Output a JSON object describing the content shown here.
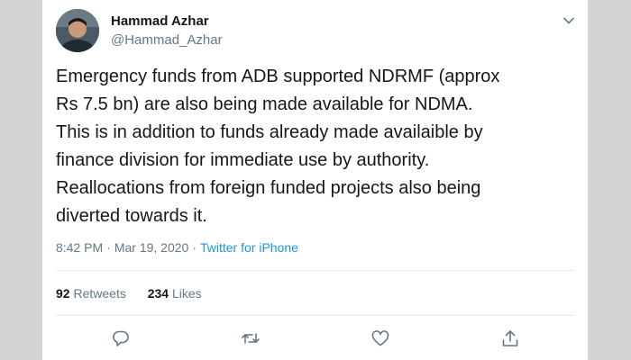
{
  "author": {
    "name": "Hammad Azhar",
    "handle": "@Hammad_Azhar"
  },
  "tweet": {
    "text": "Emergency funds from ADB supported NDRMF (approx\nRs 7.5 bn) are also being made available for NDMA.\nThis is in addition to funds already made availaible by\nfinance division for immediate use by authority.\nReallocations from foreign funded projects also being\ndiverted towards it.",
    "time": "8:42 PM",
    "separator": "·",
    "date": "Mar 19, 2020",
    "source": "Twitter for iPhone"
  },
  "stats": {
    "retweets_count": "92",
    "retweets_label": "Retweets",
    "likes_count": "234",
    "likes_label": "Likes"
  },
  "colors": {
    "text": "#14171a",
    "secondary": "#657786",
    "link": "#1b95e0",
    "divider": "#e6ecf0"
  },
  "icons": [
    "chevron-down-icon",
    "reply-icon",
    "retweet-icon",
    "like-icon",
    "share-icon"
  ]
}
